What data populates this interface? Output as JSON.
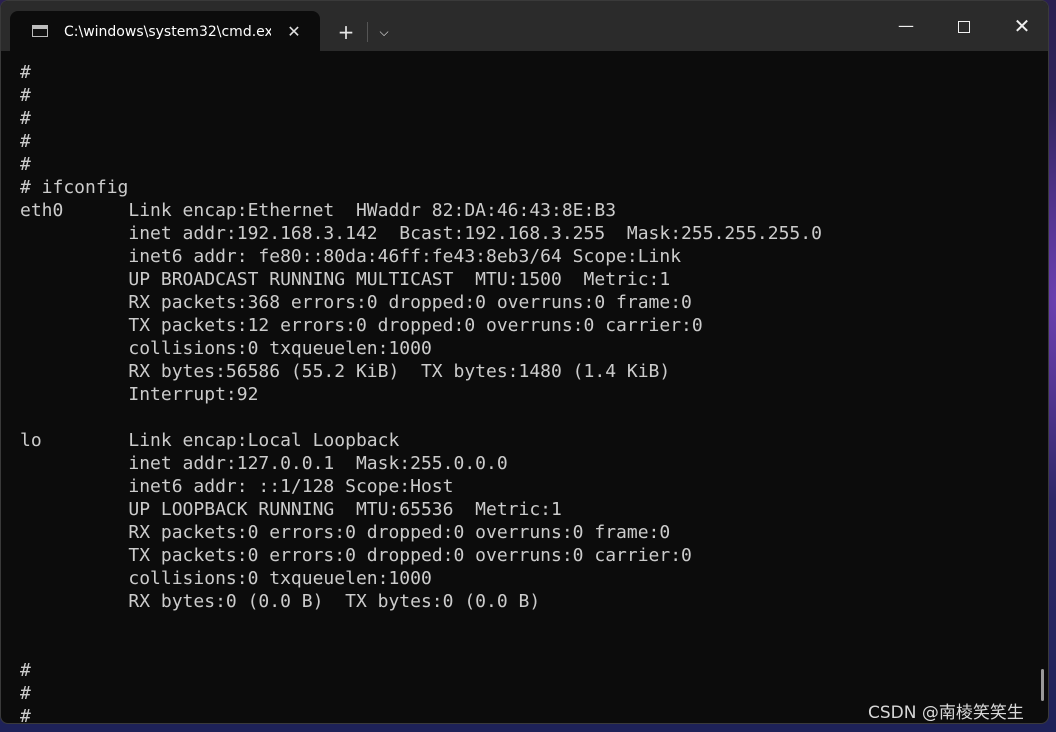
{
  "window": {
    "tab_title": "C:\\windows\\system32\\cmd.ex",
    "tab_close_glyph": "✕",
    "new_tab_glyph": "+",
    "dropdown_glyph": "⌵",
    "minimize_glyph": "—",
    "close_glyph": "✕"
  },
  "terminal": {
    "background": "#0c0c0c",
    "foreground": "#cccccc",
    "lines": [
      "#",
      "#",
      "#",
      "#",
      "#",
      "# ifconfig",
      "eth0      Link encap:Ethernet  HWaddr 82:DA:46:43:8E:B3",
      "          inet addr:192.168.3.142  Bcast:192.168.3.255  Mask:255.255.255.0",
      "          inet6 addr: fe80::80da:46ff:fe43:8eb3/64 Scope:Link",
      "          UP BROADCAST RUNNING MULTICAST  MTU:1500  Metric:1",
      "          RX packets:368 errors:0 dropped:0 overruns:0 frame:0",
      "          TX packets:12 errors:0 dropped:0 overruns:0 carrier:0",
      "          collisions:0 txqueuelen:1000",
      "          RX bytes:56586 (55.2 KiB)  TX bytes:1480 (1.4 KiB)",
      "          Interrupt:92",
      "",
      "lo        Link encap:Local Loopback",
      "          inet addr:127.0.0.1  Mask:255.0.0.0",
      "          inet6 addr: ::1/128 Scope:Host",
      "          UP LOOPBACK RUNNING  MTU:65536  Metric:1",
      "          RX packets:0 errors:0 dropped:0 overruns:0 frame:0",
      "          TX packets:0 errors:0 dropped:0 overruns:0 carrier:0",
      "          collisions:0 txqueuelen:1000",
      "          RX bytes:0 (0.0 B)  TX bytes:0 (0.0 B)",
      "",
      "",
      "#",
      "#",
      "#"
    ]
  },
  "watermark": "CSDN @南棱笑笑生"
}
